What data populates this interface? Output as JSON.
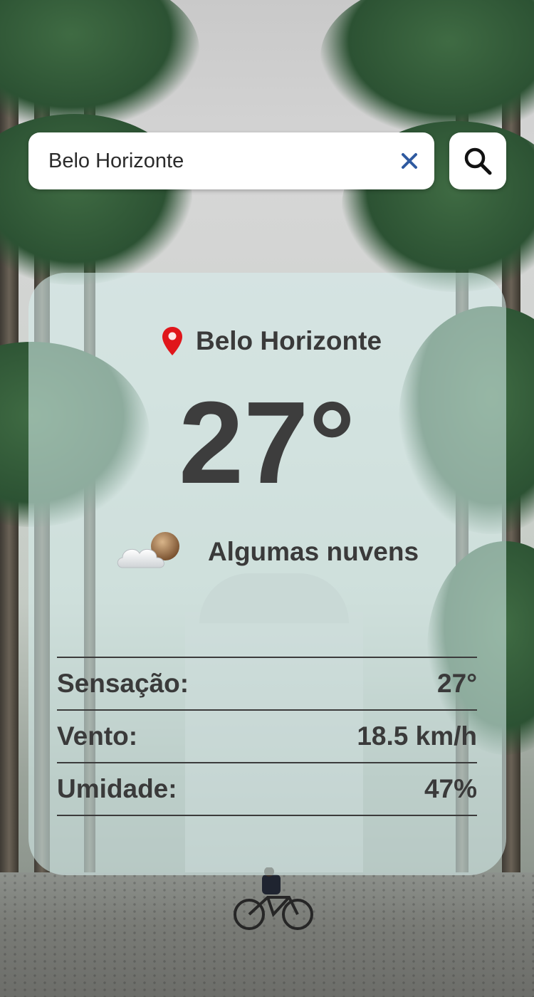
{
  "search": {
    "value": "Belo Horizonte",
    "clear_icon": "close-icon",
    "search_icon": "search-icon"
  },
  "weather": {
    "location_icon": "map-pin-icon",
    "city": "Belo Horizonte",
    "temperature": "27°",
    "condition_icon": "partly-cloudy-icon",
    "condition": "Algumas nuvens"
  },
  "details": [
    {
      "label": "Sensação:",
      "value": "27°"
    },
    {
      "label": "Vento:",
      "value": "18.5 km/h"
    },
    {
      "label": "Umidade:",
      "value": "47%"
    }
  ],
  "colors": {
    "pin": "#e0161b",
    "clear_x": "#2f5aa0",
    "text": "#3a3a3a",
    "card": "rgba(214,238,236,0.58)"
  }
}
